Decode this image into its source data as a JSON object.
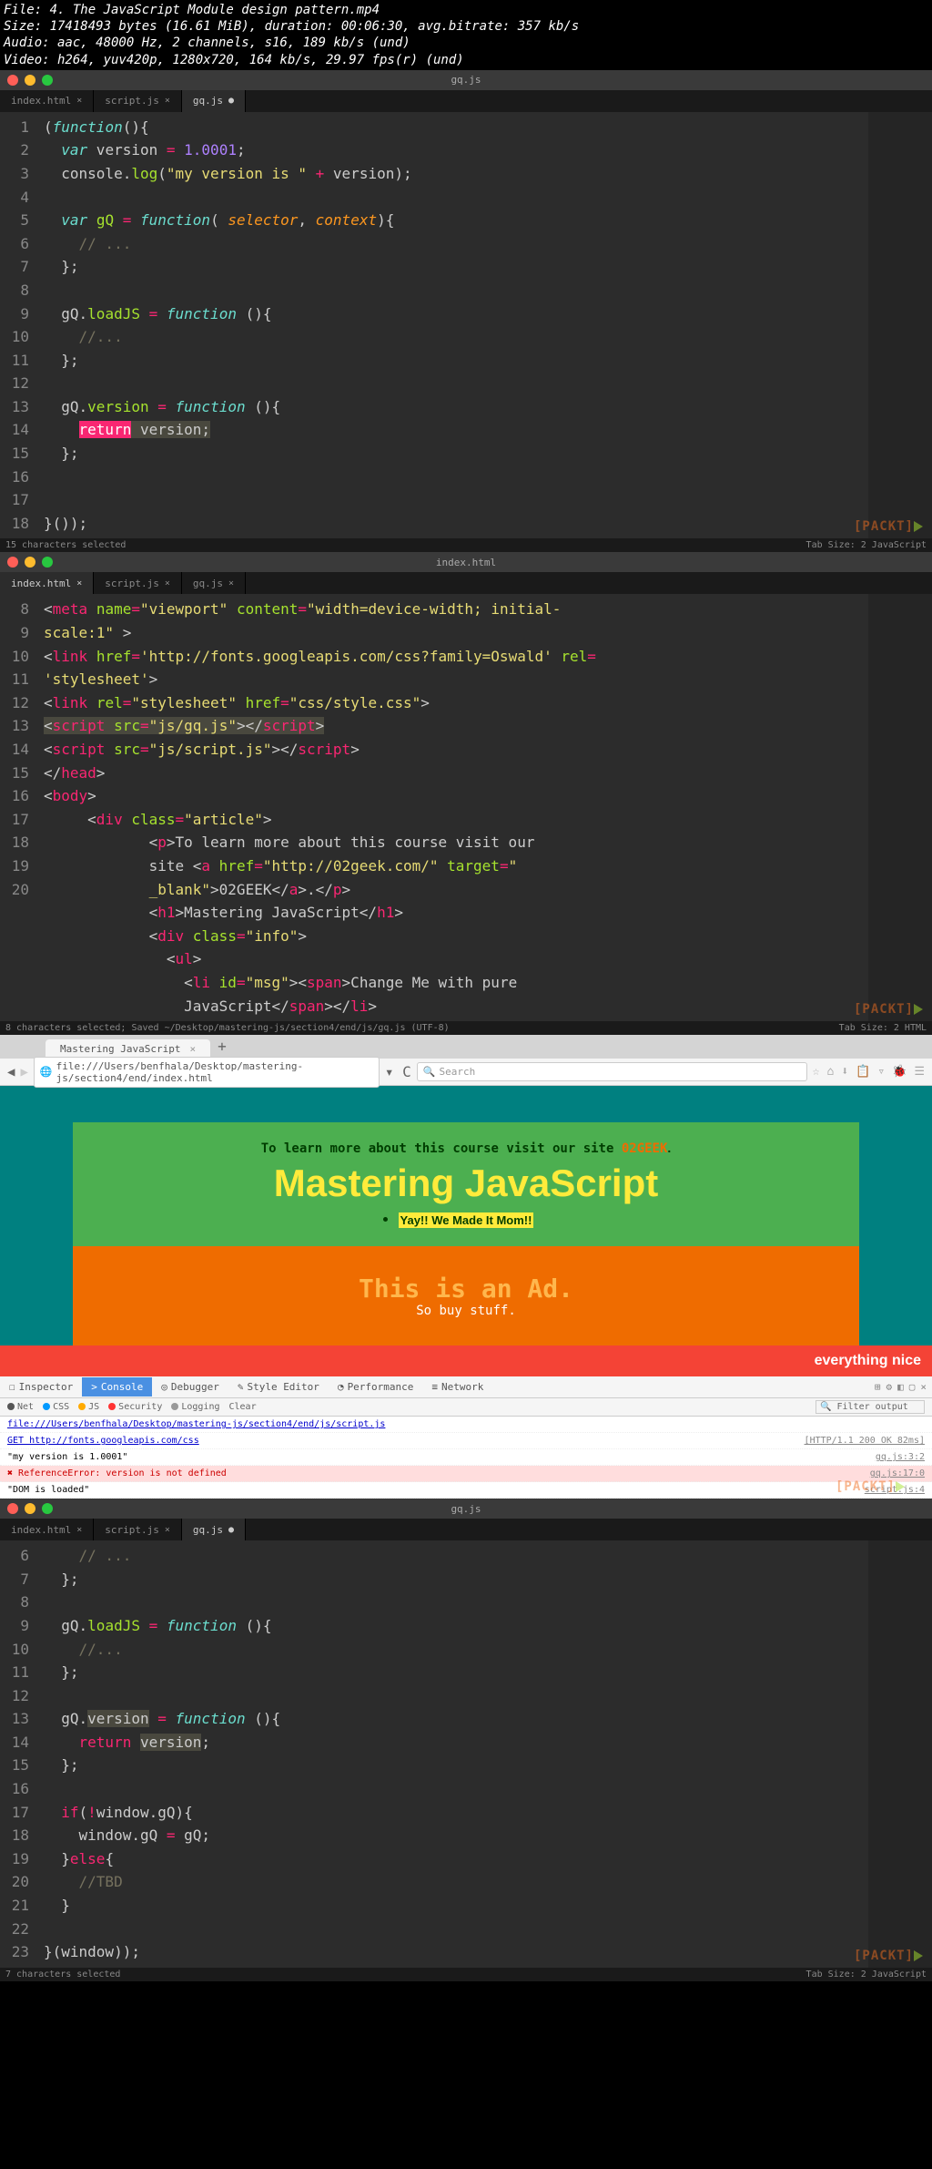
{
  "meta": {
    "file": "File: 4. The JavaScript Module design pattern.mp4",
    "size": "Size: 17418493 bytes (16.61 MiB), duration: 00:06:30, avg.bitrate: 357 kb/s",
    "audio": "Audio: aac, 48000 Hz, 2 channels, s16, 189 kb/s (und)",
    "video": "Video: h264, yuv420p, 1280x720, 164 kb/s, 29.97 fps(r) (und)"
  },
  "editor1": {
    "title": "gq.js",
    "tabs": [
      "index.html",
      "script.js",
      "gq.js"
    ],
    "gutter": [
      "1",
      "2",
      "3",
      "4",
      "5",
      "6",
      "7",
      "8",
      "9",
      "10",
      "11",
      "12",
      "13",
      "14",
      "15",
      "16",
      "17",
      "18"
    ],
    "status_left": "15 characters selected",
    "status_right": "Tab Size: 2   JavaScript"
  },
  "editor2": {
    "title": "index.html",
    "tabs": [
      "index.html",
      "script.js",
      "gq.js"
    ],
    "gutter": [
      "8",
      "",
      "9",
      "",
      "10",
      "11",
      "12",
      "13",
      "14",
      "15",
      "16",
      "",
      "",
      "17",
      "18",
      "19",
      "20",
      ""
    ],
    "status_left": "8 characters selected; Saved ~/Desktop/mastering-js/section4/end/js/gq.js (UTF-8)",
    "status_right": "Tab Size: 2   HTML"
  },
  "browser": {
    "tab_title": "Mastering JavaScript",
    "url": "file:///Users/benfhala/Desktop/mastering-js/section4/end/index.html",
    "search_ph": "Search",
    "learn_more_pre": "To learn more about this course visit our site ",
    "learn_more_link": "02GEEK",
    "h1": "Mastering JavaScript",
    "bullet": "Yay!! We Made It Mom!!",
    "ad_pre": "This is ",
    "ad_em": "an Ad.",
    "ad_sub": "So buy stuff.",
    "nice": "everything nice"
  },
  "devtools": {
    "tabs": [
      "Inspector",
      "Console",
      "Debugger",
      "Style Editor",
      "Performance",
      "Network"
    ],
    "sub": [
      "Net",
      "CSS",
      "JS",
      "Security",
      "Logging",
      "Clear"
    ],
    "filter_ph": "Filter output",
    "line1": "file:///Users/benfhala/Desktop/mastering-js/section4/end/js/script.js",
    "line2_l": "GET http://fonts.googleapis.com/css",
    "line2_r": "[HTTP/1.1 200 OK 82ms]",
    "line3_l": "\"my version is 1.0001\"",
    "line3_r": "gq.js:3:2",
    "err": "ReferenceError: version is not defined",
    "err_r": "gq.js:17:0",
    "line5_l": "\"DOM is loaded\"",
    "line5_r": "script.js:4"
  },
  "editor3": {
    "title": "gq.js",
    "tabs": [
      "index.html",
      "script.js",
      "gq.js"
    ],
    "gutter": [
      "6",
      "7",
      "8",
      "9",
      "10",
      "11",
      "12",
      "13",
      "14",
      "15",
      "16",
      "17",
      "18",
      "19",
      "20",
      "21",
      "22",
      "23"
    ],
    "status_left": "7 characters selected",
    "status_right": "Tab Size: 2   JavaScript"
  },
  "watermark": "[PACKT]"
}
